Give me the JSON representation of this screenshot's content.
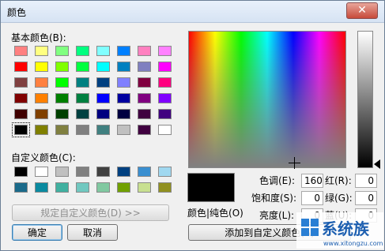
{
  "window": {
    "title": "颜色",
    "close_glyph": "✕"
  },
  "basic": {
    "label": "基本颜色(B):",
    "colors": [
      "#ff8080",
      "#ffff80",
      "#80ff80",
      "#00ff80",
      "#80ffff",
      "#0080ff",
      "#ff80c0",
      "#ff80ff",
      "#ff0000",
      "#ffff00",
      "#80ff00",
      "#00ff40",
      "#00ffff",
      "#0080c0",
      "#8080c0",
      "#ff00ff",
      "#804040",
      "#ff8040",
      "#00ff00",
      "#008080",
      "#004080",
      "#8080ff",
      "#800040",
      "#ff0080",
      "#800000",
      "#ff8000",
      "#008000",
      "#008040",
      "#0000ff",
      "#0000a0",
      "#800080",
      "#8000ff",
      "#400000",
      "#804000",
      "#004000",
      "#004040",
      "#000080",
      "#000040",
      "#400040",
      "#400080",
      "#000000",
      "#808000",
      "#808040",
      "#808080",
      "#408080",
      "#c0c0c0",
      "#400040",
      "#ffffff"
    ],
    "selected_index": 40
  },
  "custom": {
    "label": "自定义颜色(C):",
    "colors": [
      "#000000",
      "#ffffff",
      "#c0c0c0",
      "#808080",
      "#404040",
      "#004080",
      "#3a8fd0",
      "#a0d8f0",
      "#1a6a8a",
      "#0a8aa0",
      "#40b0a0",
      "#70c8c0",
      "#80c8a0",
      "#70a000",
      "#c8e090",
      "#909020"
    ]
  },
  "buttons": {
    "define_custom": "规定自定义颜色(D) >>",
    "ok": "确定",
    "cancel": "取消",
    "add_custom": "添加到自定义颜色(A)"
  },
  "preview": {
    "label": "颜色|纯色(O)",
    "color": "#000000"
  },
  "fields": {
    "hue": {
      "label": "色调(E):",
      "value": "160"
    },
    "sat": {
      "label": "饱和度(S):",
      "value": "0"
    },
    "lum": {
      "label": "亮度(L):",
      "value": "0"
    },
    "red": {
      "label": "红(R):",
      "value": "0"
    },
    "green": {
      "label": "绿(G):",
      "value": "0"
    },
    "blue": {
      "label": "蓝(U):",
      "value": "0"
    }
  },
  "watermark": {
    "text": "系统族",
    "url": "www.xitongzu.com"
  }
}
